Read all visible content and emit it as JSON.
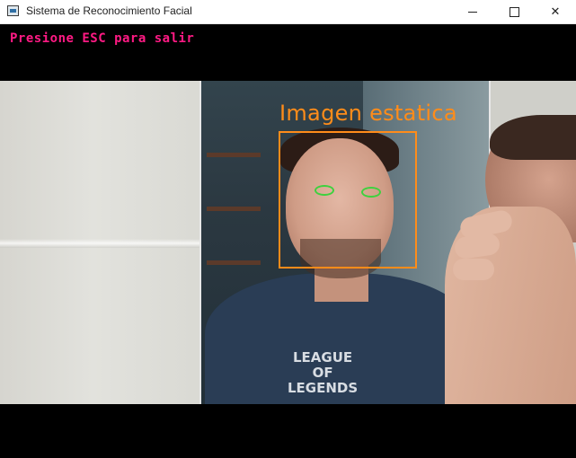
{
  "window": {
    "title": "Sistema de Reconocimiento Facial",
    "controls": {
      "minimize": "minimize-icon",
      "maximize": "maximize-icon",
      "close": "close-icon"
    }
  },
  "overlay": {
    "instruction": "Presione ESC para salir",
    "instruction_color": "#ff1a84"
  },
  "detection": {
    "label": "Imagen estatica",
    "box_color": "#ff8c1a",
    "eye_color": "#3ed13e"
  },
  "photo": {
    "shirt_logo": "LEAGUE\nOF\nLEGENDS"
  },
  "footer": {
    "cutoff_text": "..."
  }
}
